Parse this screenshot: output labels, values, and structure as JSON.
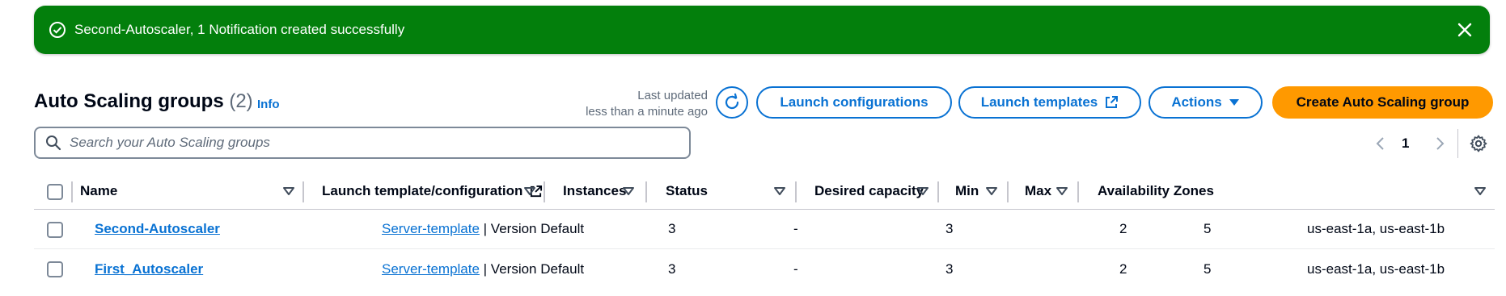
{
  "flash": {
    "message": "Second-Autoscaler, 1 Notification created successfully",
    "color": "#037f0c"
  },
  "header": {
    "title": "Auto Scaling groups",
    "count": "(2)",
    "info": "Info",
    "last_updated_label": "Last updated",
    "last_updated_value": "less than a minute ago"
  },
  "buttons": {
    "launch_configurations": "Launch configurations",
    "launch_templates": "Launch templates",
    "actions": "Actions",
    "create": "Create Auto Scaling group"
  },
  "search": {
    "placeholder": "Search your Auto Scaling groups"
  },
  "pagination": {
    "current_page": "1"
  },
  "table": {
    "columns": [
      "Name",
      "Launch template/configuration",
      "Instances",
      "Status",
      "Desired capacity",
      "Min",
      "Max",
      "Availability Zones"
    ],
    "rows": [
      {
        "name": "Second-Autoscaler",
        "template": "Server-template",
        "version": " | Version Default",
        "instances": "3",
        "status": "-",
        "desired": "3",
        "min": "2",
        "max": "5",
        "zones": "us-east-1a, us-east-1b"
      },
      {
        "name": "First_Autoscaler",
        "template": "Server-template",
        "version": " | Version Default",
        "instances": "3",
        "status": "-",
        "desired": "3",
        "min": "2",
        "max": "5",
        "zones": "us-east-1a, us-east-1b"
      }
    ]
  },
  "colors": {
    "accent": "#0972d3",
    "primary": "#ff9900",
    "success": "#037f0c"
  }
}
